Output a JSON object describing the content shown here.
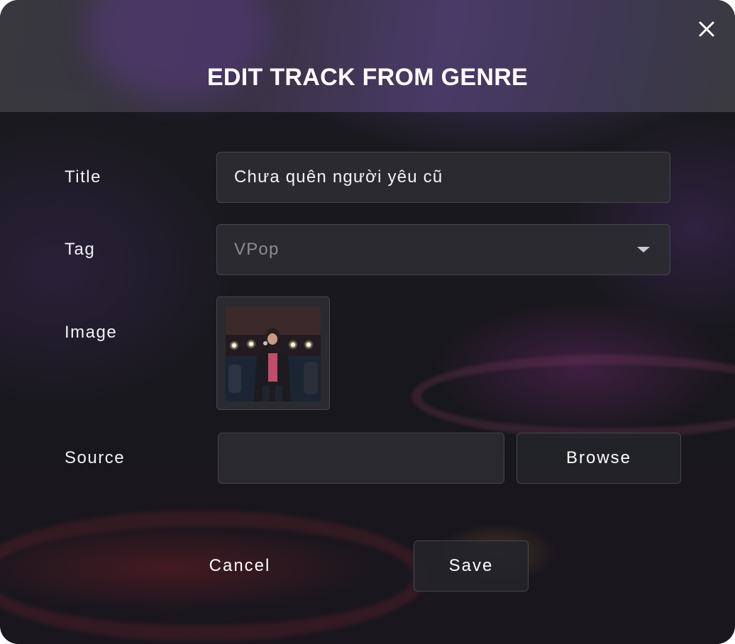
{
  "dialog": {
    "title": "EDIT TRACK FROM GENRE",
    "close_icon": "close-icon"
  },
  "form": {
    "title_label": "Title",
    "title_value": "Chưa quên người yêu cũ",
    "tag_label": "Tag",
    "tag_selected": "VPop",
    "tag_icon": "chevron-down-icon",
    "image_label": "Image",
    "image_alt": "",
    "source_label": "Source",
    "source_value": "",
    "browse_label": "Browse"
  },
  "actions": {
    "cancel_label": "Cancel",
    "save_label": "Save"
  },
  "colors": {
    "dialog_bg": "#17171b",
    "header_accent": "#4a3a68",
    "field_border": "#46464c",
    "text": "#ffffff",
    "placeholder": "#8c8c92"
  }
}
